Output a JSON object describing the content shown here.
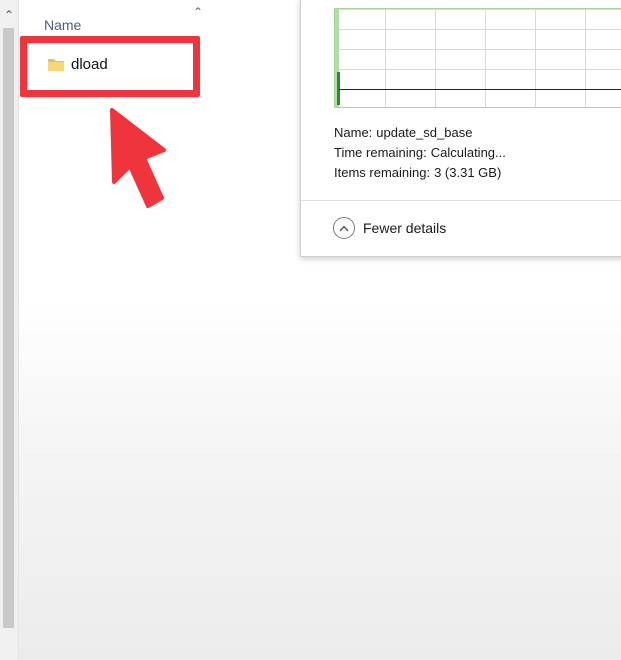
{
  "explorer": {
    "column_name": "Name",
    "files": [
      {
        "label": "dload",
        "icon": "folder-icon"
      }
    ]
  },
  "annotation": {
    "highlight_color": "#f0343c",
    "arrow_color": "#f0343c"
  },
  "copy_dialog": {
    "name_label": "Name:",
    "name_value": "update_sd_base",
    "time_label": "Time remaining:",
    "time_value": "Calculating...",
    "items_label": "Items remaining:",
    "items_value": "3 (3.31 GB)",
    "fewer_details": "Fewer details",
    "graph_color": "#2b8a2b"
  }
}
